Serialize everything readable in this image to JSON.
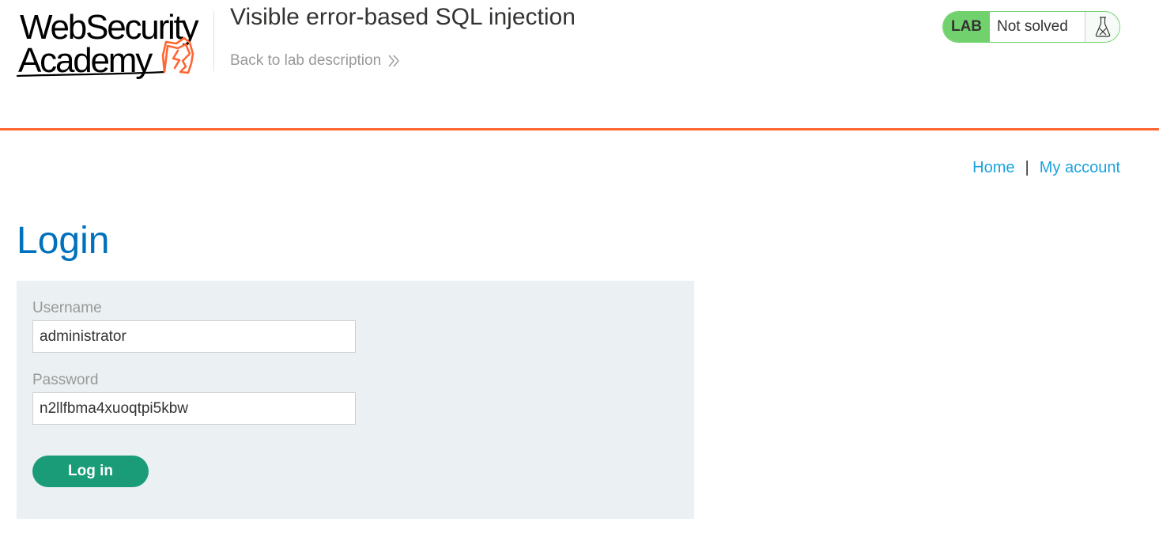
{
  "header": {
    "logo": {
      "line1": "WebSecurity",
      "line2": "Academy"
    },
    "lab_title": "Visible error-based SQL injection",
    "back_link": "Back to lab description",
    "lab_status": {
      "badge": "LAB",
      "state": "Not solved",
      "icon": "flask-icon"
    }
  },
  "nav": {
    "home": "Home",
    "separator": "|",
    "my_account": "My account"
  },
  "main": {
    "title": "Login",
    "form": {
      "username_label": "Username",
      "username_value": "administrator",
      "password_label": "Password",
      "password_value": "n2llfbma4xuoqtpi5kbw",
      "submit_label": "Log in"
    }
  },
  "colors": {
    "accent_orange": "#ff6633",
    "link_blue": "#1ba2e0",
    "title_blue": "#0071bc",
    "lab_green": "#70d16d",
    "button_green": "#1a9c79",
    "panel_gray": "#ebf0f2"
  }
}
